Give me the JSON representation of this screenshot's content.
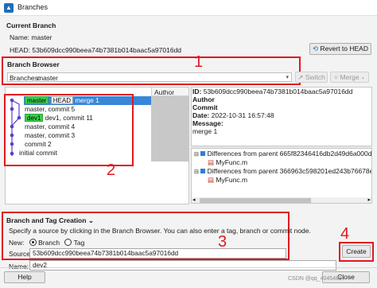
{
  "window": {
    "title": "Branches",
    "icon": "matlab-icon"
  },
  "current_branch": {
    "heading": "Current Branch",
    "name_label": "Name:",
    "name_value": "master",
    "head_label": "HEAD:",
    "head_value": "53b609dcc990beea74b7381b014baac5a97016dd",
    "revert_button": "Revert to HEAD"
  },
  "branch_browser": {
    "heading": "Branch Browser",
    "branches_label": "Branches:",
    "branches_value": "master",
    "switch_button": "Switch",
    "merge_button": "Merge",
    "author_header": "Author",
    "commits": [
      {
        "tags": [
          "master",
          "HEAD"
        ],
        "green": [
          true,
          false
        ],
        "text": "merge 1",
        "selected": true
      },
      {
        "tags": [],
        "green": [],
        "text": "master, commit 5",
        "selected": false
      },
      {
        "tags": [
          "dev1"
        ],
        "green": [
          true
        ],
        "text": "dev1, commit 11",
        "selected": false
      },
      {
        "tags": [],
        "green": [],
        "text": "master, commit 4",
        "selected": false
      },
      {
        "tags": [],
        "green": [],
        "text": "master, commit 3",
        "selected": false
      },
      {
        "tags": [],
        "green": [],
        "text": "commit 2",
        "selected": false
      },
      {
        "tags": [],
        "green": [],
        "text": "initial commit",
        "selected": false
      }
    ],
    "details": {
      "id_label": "ID:",
      "id_value": "53b609dcc990beea74b7381b014baac5a97016dd",
      "author_label": "Author",
      "commit_label": "Commit",
      "date_label": "Date:",
      "date_value": "2022-10-31 16:57:48",
      "message_label": "Message:",
      "message_value": "merge 1"
    },
    "diffs": [
      {
        "label": "Differences from parent 665f82346416db2d49d6a000dd",
        "file": "MyFunc.m"
      },
      {
        "label": "Differences from parent 366963c598201ed243b76678ee",
        "file": "MyFunc.m"
      }
    ]
  },
  "creation": {
    "heading": "Branch and Tag Creation",
    "hint": "Specify a source by clicking in the Branch Browser. You can also enter a tag, branch or commit node.",
    "new_label": "New:",
    "radio_branch": "Branch",
    "radio_tag": "Tag",
    "source_label": "Source:",
    "source_value": "53b609dcc990beea74b7381b014baac5a97016dd",
    "name_label": "Name:",
    "name_value": "dev2",
    "create_button": "Create"
  },
  "footer": {
    "help_button": "Help",
    "close_button": "Close",
    "watermark": "CSDN @qq_40454887"
  },
  "annotations": {
    "n1": "1",
    "n2": "2",
    "n3": "3",
    "n4": "4"
  },
  "colors": {
    "annotation_red": "#e0191f",
    "selection_blue": "#3a87d8",
    "tag_green": "#3cd24c",
    "graph_purple": "#5a3fd0"
  }
}
